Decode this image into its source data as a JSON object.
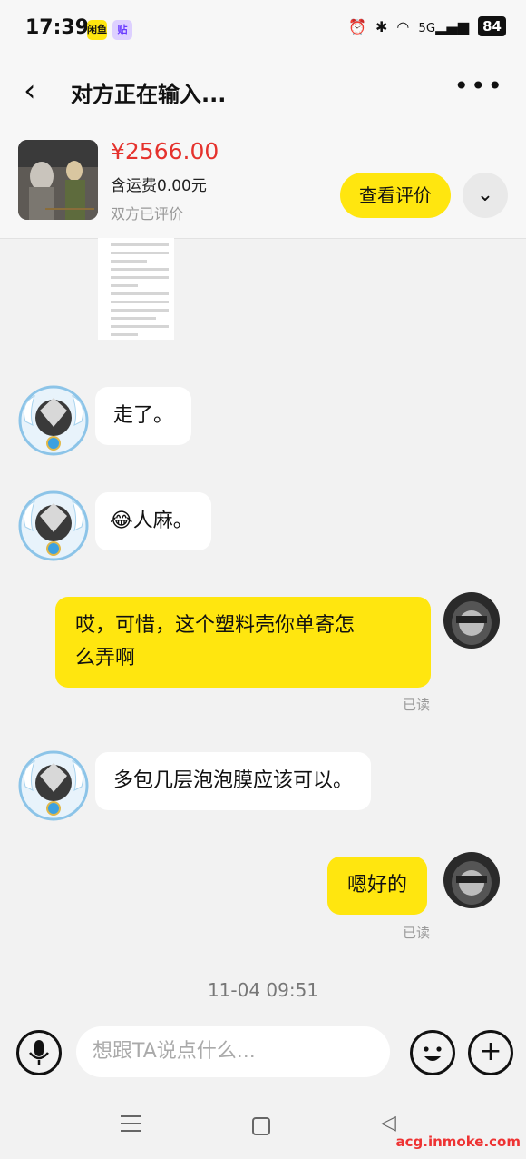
{
  "status": {
    "time": "17:39",
    "app1": "闲鱼",
    "app2": "贴",
    "network": "5G",
    "battery": "84"
  },
  "header": {
    "back_icon": "‹",
    "title": "对方正在输入...",
    "more_icon": "•••"
  },
  "product": {
    "price": "¥2566.00",
    "shipping": "含运费0.00元",
    "rated": "双方已评价",
    "review_button": "查看评价",
    "expand_icon": "⌄"
  },
  "messages": [
    {
      "side": "left",
      "text": "走了。"
    },
    {
      "side": "left",
      "emoji": "😂",
      "text": "人麻。"
    },
    {
      "side": "right",
      "text_line1": "哎，可惜，这个塑料壳你单寄怎",
      "text_line2": "么弄啊",
      "status": "已读"
    },
    {
      "side": "left",
      "text": "多包几层泡泡膜应该可以。"
    },
    {
      "side": "right",
      "text": "嗯好的",
      "status": "已读"
    }
  ],
  "timestamp": "11-04 09:51",
  "input": {
    "placeholder": "想跟TA说点什么..."
  },
  "watermark": "acg.inmoke.com",
  "colors": {
    "accent": "#ffe60f",
    "price": "#e5322d"
  }
}
